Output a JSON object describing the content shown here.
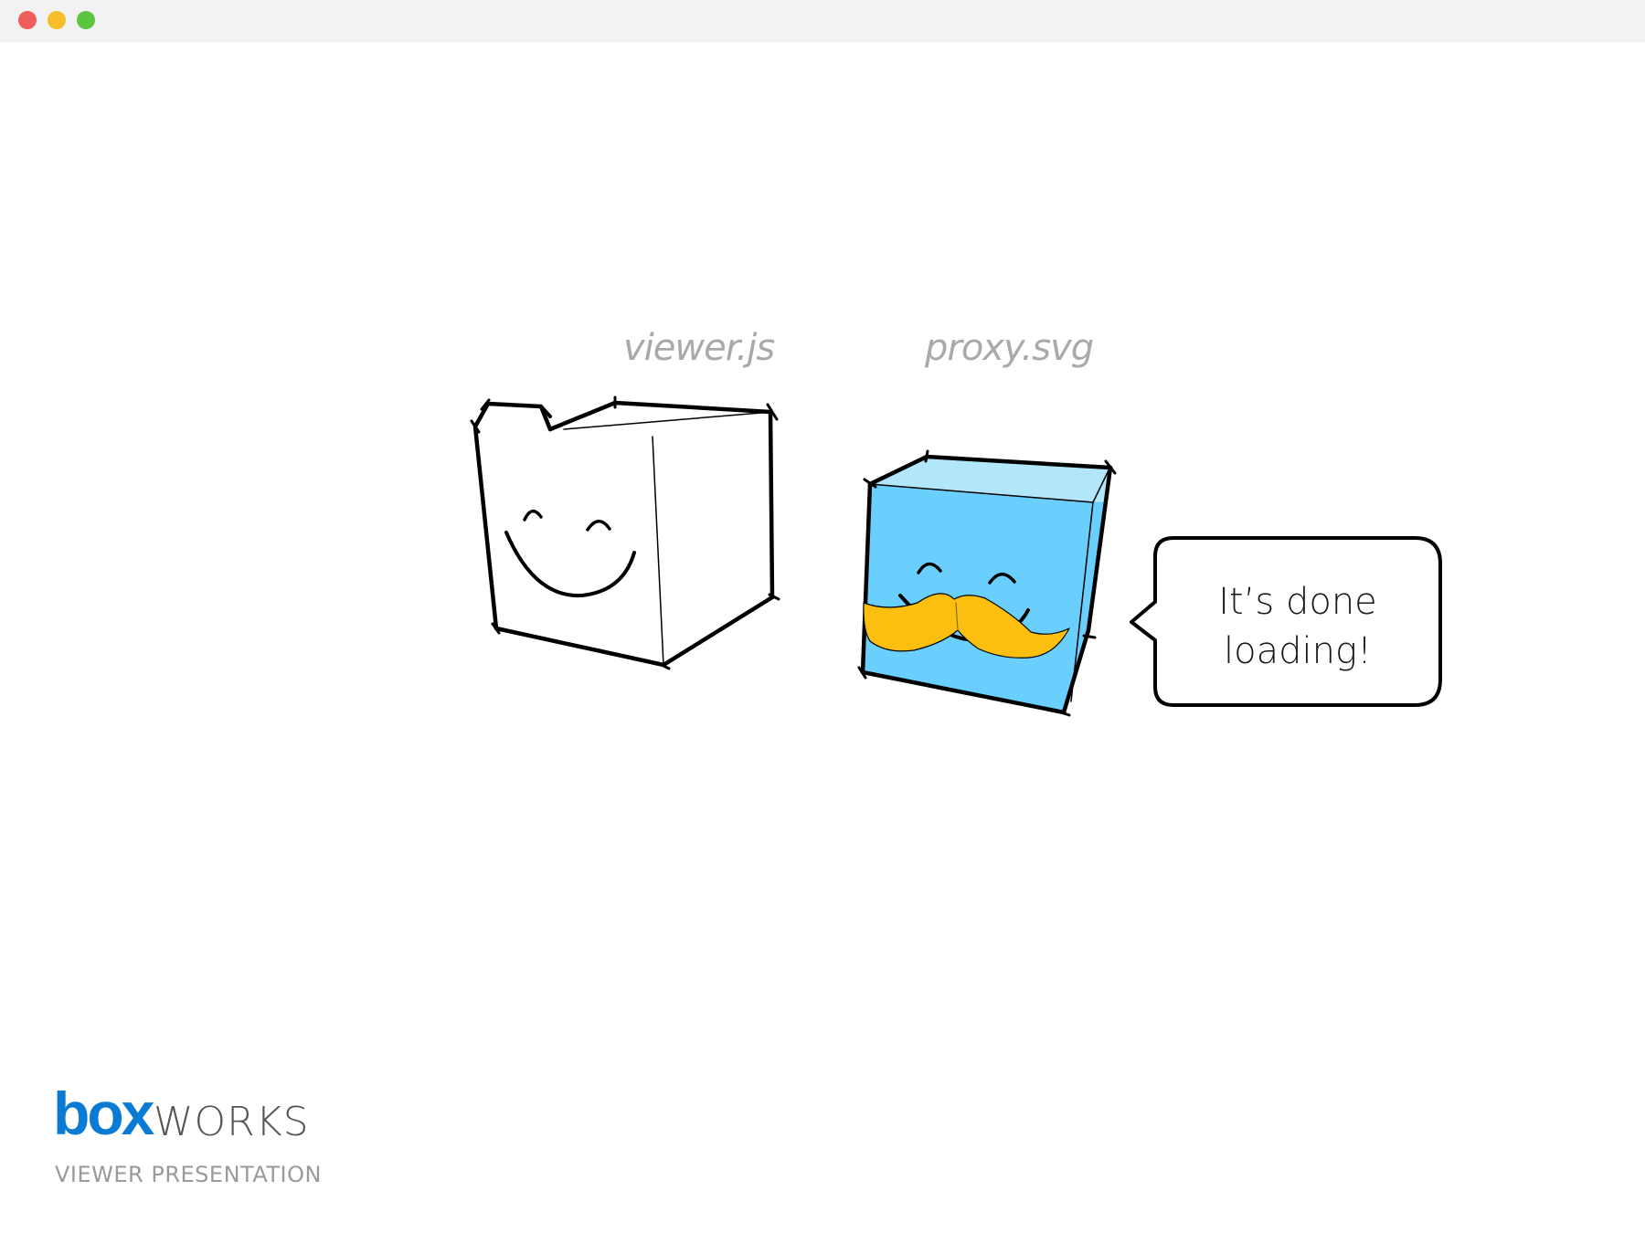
{
  "window": {
    "controls": [
      {
        "name": "close",
        "color": "#ee5f5b"
      },
      {
        "name": "minimize",
        "color": "#f6be2b"
      },
      {
        "name": "maximize",
        "color": "#5cc43f"
      }
    ]
  },
  "slide": {
    "cube_left_label": "viewer.js",
    "cube_right_label": "proxy.svg",
    "speech_line1": "It’s done",
    "speech_line2": "loading!",
    "illustration": {
      "left_cube": "smiling white cube (open lid)",
      "right_cube": "smiling blue cube with mustache"
    }
  },
  "branding": {
    "logo_box": "box",
    "logo_works": "WORKS",
    "subtitle": "VIEWER PRESENTATION"
  },
  "colors": {
    "box_blue": "#0a7bd4",
    "cube_blue": "#6acffd",
    "cube_top_blue": "#b2e6fb",
    "mustache": "#fdbf0f",
    "label_gray": "#a9a9a9"
  }
}
